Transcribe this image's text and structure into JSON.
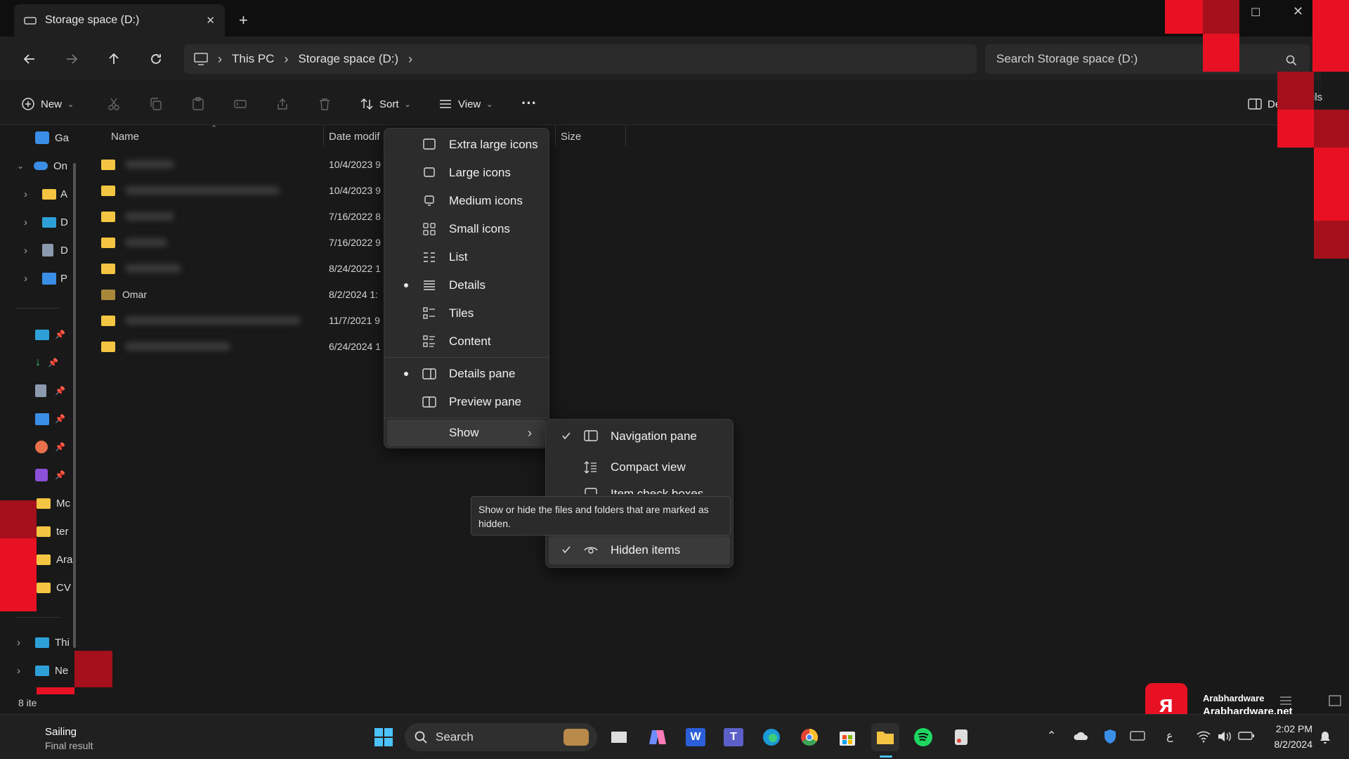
{
  "tab": {
    "title": "Storage space (D:)",
    "close": "✕",
    "new": "+"
  },
  "window_controls": {
    "minimize": "—",
    "maximize": "☐",
    "close": "✕"
  },
  "address": {
    "crumbs": [
      "This PC",
      "Storage space (D:)"
    ]
  },
  "search": {
    "placeholder": "Search Storage space (D:)"
  },
  "toolbar": {
    "new": "New",
    "sort": "Sort",
    "view": "View",
    "more": "···",
    "details": "Details",
    "details_clip": "ils"
  },
  "sidebar": {
    "items": [
      "Ga",
      "On",
      "A",
      "D",
      "D",
      "P"
    ],
    "folders": [
      "Mc",
      "ter",
      "Ara",
      "CV"
    ],
    "bottom": [
      "Thi",
      "Ne"
    ]
  },
  "columns": {
    "name": "Name",
    "date": "Date modif",
    "size": "Size"
  },
  "files": [
    {
      "name": "",
      "date": "10/4/2023 9"
    },
    {
      "name": "",
      "date": "10/4/2023 9"
    },
    {
      "name": "",
      "date": "7/16/2022 8"
    },
    {
      "name": "",
      "date": "7/16/2022 9"
    },
    {
      "name": "",
      "date": "8/24/2022 1"
    },
    {
      "name": "Omar",
      "date": "8/2/2024 1:"
    },
    {
      "name": "",
      "date": "11/7/2021 9"
    },
    {
      "name": "",
      "date": "6/24/2024 1"
    }
  ],
  "view_menu": {
    "items": [
      "Extra large icons",
      "Large icons",
      "Medium icons",
      "Small icons",
      "List",
      "Details",
      "Tiles",
      "Content"
    ],
    "panes": [
      "Details pane",
      "Preview pane"
    ],
    "show": "Show",
    "selected_layout": "Details",
    "selected_pane": "Details pane"
  },
  "show_menu": {
    "items": [
      "Navigation pane",
      "Compact view",
      "Item check boxes",
      "Hidden items"
    ]
  },
  "tooltip": "Show or hide the files and folders that are marked as hidden.",
  "status": {
    "count": "8 ite"
  },
  "weather": {
    "title": "Sailing",
    "sub": "Final result"
  },
  "taskbar": {
    "search": "Search",
    "time": "2:02 PM",
    "date": "8/2/2024",
    "lang": "ع"
  },
  "watermark": {
    "social": "Arabhardware",
    "site": "Arabhardware.net"
  },
  "colors": {
    "accent_red": "#e81123",
    "folder": "#f4c542",
    "menu_bg": "#2c2c2c"
  }
}
